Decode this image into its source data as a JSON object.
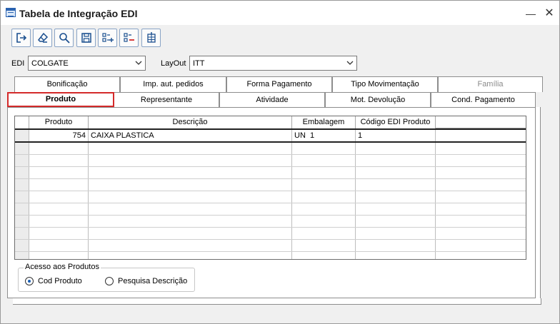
{
  "window": {
    "title": "Tabela de Integração EDI"
  },
  "toolbar": {
    "buttons": [
      "exit-icon",
      "eraser-icon",
      "search-icon",
      "save-icon",
      "add-row-icon",
      "remove-row-icon",
      "grid-settings-icon"
    ]
  },
  "filters": {
    "edi_label": "EDI",
    "edi_value": "COLGATE",
    "layout_label": "LayOut",
    "layout_value": "ITT"
  },
  "tabs_row1": [
    "Bonificação",
    "Imp. aut. pedidos",
    "Forma Pagamento",
    "Tipo Movimentação",
    "Família"
  ],
  "tabs_row2": [
    "Produto",
    "Representante",
    "Atividade",
    "Mot. Devolução",
    "Cond. Pagamento"
  ],
  "active_tab": "Produto",
  "grid": {
    "columns": [
      "Produto",
      "Descrição",
      "Embalagem",
      "Código EDI Produto"
    ],
    "rows": [
      {
        "produto": "754",
        "descricao": "CAIXA PLASTICA",
        "embalagem": "UN  1",
        "codigo": "1"
      }
    ]
  },
  "acesso": {
    "legend": "Acesso aos Produtos",
    "options": [
      "Cod Produto",
      "Pesquisa Descrição"
    ],
    "selected": "Cod Produto"
  },
  "colors": {
    "active_tab_border": "#d42a2a",
    "accent": "#1a5fb4"
  }
}
